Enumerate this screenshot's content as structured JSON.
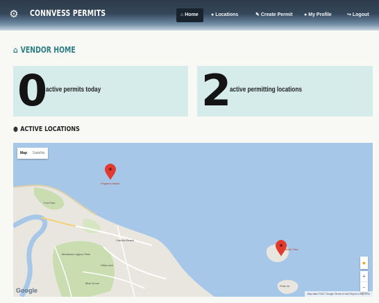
{
  "navbar": {
    "logo_icon": "gear-icon",
    "brand": "CONNVESS PERMITS",
    "items": [
      {
        "label": "Home",
        "icon": "home-icon",
        "active": true
      },
      {
        "label": "Locations",
        "icon": "map-pin-icon",
        "active": false
      },
      {
        "label": "Create Permit",
        "icon": "pencil-icon",
        "active": false
      },
      {
        "label": "My Profile",
        "icon": "user-icon",
        "active": false
      },
      {
        "label": "Logout",
        "icon": "logout-icon",
        "active": false
      }
    ]
  },
  "page": {
    "title": "VENDOR HOME",
    "title_icon": "home-icon"
  },
  "stats": [
    {
      "value": "0",
      "label": "active permits today"
    },
    {
      "value": "2",
      "label": "active permitting locations"
    }
  ],
  "locations_section": {
    "title": "ACTIVE LOCATIONS",
    "title_icon": "map-marker-icon"
  },
  "map": {
    "type_options": [
      {
        "label": "Map",
        "selected": true
      },
      {
        "label": "Satellite",
        "selected": false
      }
    ],
    "pins": [
      {
        "label": "Pegasus Island"
      },
      {
        "label": "Meitu Tiea"
      }
    ],
    "place_labels": [
      "Fort Park",
      "Cambia Beach",
      "Meadows Lagoon Park",
      "Hilton Ave",
      "Blue Grove",
      "Pelle Isl"
    ],
    "logo": "Google",
    "attribution": "Map data ©2017 Google   Terms of Use   Report a map error",
    "zoom_in": "+",
    "zoom_out": "−"
  },
  "colors": {
    "navbar": "#34475a",
    "accent": "#2f7d83",
    "card_bg": "#d5eceb",
    "water": "#a7c7e9",
    "land": "#e9e6df",
    "park": "#c9ddb0",
    "pin": "#e03b2f"
  }
}
